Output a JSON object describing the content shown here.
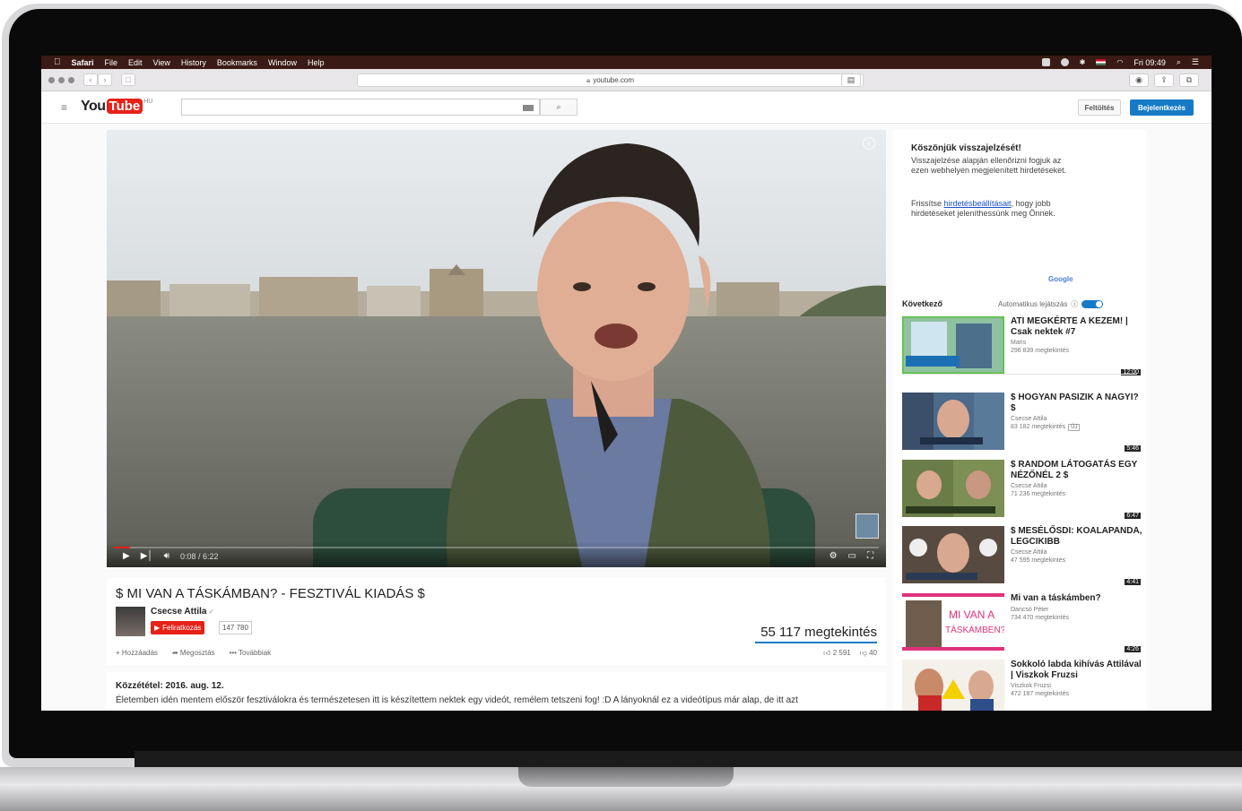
{
  "menubar": {
    "apple": "",
    "app_name": "Safari",
    "items": [
      "File",
      "Edit",
      "View",
      "History",
      "Bookmarks",
      "Window",
      "Help"
    ],
    "clock": "Fri 09:49"
  },
  "safari": {
    "url": "youtube.com"
  },
  "youtube": {
    "logo_you": "You",
    "logo_tube": "Tube",
    "country": "HU",
    "upload_label": "Feltöltés",
    "signin_label": "Bejelentkezés",
    "search_placeholder": ""
  },
  "player": {
    "time_current": "0:08",
    "time_total": "6:22",
    "time_display": "0:08 / 6:22",
    "progress_fraction": 0.021
  },
  "video": {
    "title": "$ MI VAN A TÁSKÁMBAN? - FESZTIVÁL KIADÁS $",
    "channel": "Csecse Attila",
    "subscribe_label": "Feliratkozás",
    "subscriber_count": "147 780",
    "views": "55 117 megtekintés",
    "actions": [
      "Hozzáadás",
      "Megosztás",
      "••• Továbbiak"
    ],
    "likes": "2 591",
    "dislikes": "40",
    "published": "Közzététel: 2016. aug. 12.",
    "description": "Életemben idén mentem először fesztiválokra és természetesen itt is készítettem nektek egy videót, remélem tetszeni fog! :D A lányoknál ez a videótípus már alap, de itt azt"
  },
  "ad": {
    "title": "Köszönjük visszajelzését!",
    "line1": "Visszajelzése alapján ellenőrizni fogjuk az ezen webhelyen megjelenített hirdetéseket.",
    "line2_pre": "Frissítse ",
    "line2_link": "hirdetésbeállításait",
    "line2_post": ", hogy jobb hirdetéseket jeleníthessünk meg Önnek.",
    "brand": "Google"
  },
  "upnext": {
    "header": "Következő",
    "autoplay_label": "Automatikus lejátszás",
    "items": [
      {
        "title": "ATI MEGKÉRTE A KEZEM! | Csak nektek #7",
        "channel": "Maris",
        "views": "296 839 megtekintés",
        "duration": "12:00"
      },
      {
        "title": "$ HOGYAN PASIZIK A NAGYI? $",
        "channel": "Csecse Attila",
        "views": "83 182 megtekintés",
        "duration": "5:46",
        "badge": "ÚJ"
      },
      {
        "title": "$ RANDOM LÁTOGATÁS EGY NÉZŐNÉL 2 $",
        "channel": "Csecse Attila",
        "views": "71 236 megtekintés",
        "duration": "6:47"
      },
      {
        "title": "$ MESÉLŐSDI: KOALAPANDA, LEGCIKIBB",
        "channel": "Csecse Attila",
        "views": "47 595 megtekintés",
        "duration": "4:41"
      },
      {
        "title": "Mi van a táskámben?",
        "channel": "Dancsó Péter",
        "views": "734 470 megtekintés",
        "duration": "4:26"
      },
      {
        "title": "Sokkoló labda kihívás Attilával | Viszkok Fruzsi",
        "channel": "Viszkok Fruzsi",
        "views": "472 187 megtekintés",
        "duration": ""
      }
    ]
  },
  "colors": {
    "youtube_red": "#e62117",
    "link_blue": "#167ac6",
    "menubar": "#3a1a14"
  }
}
